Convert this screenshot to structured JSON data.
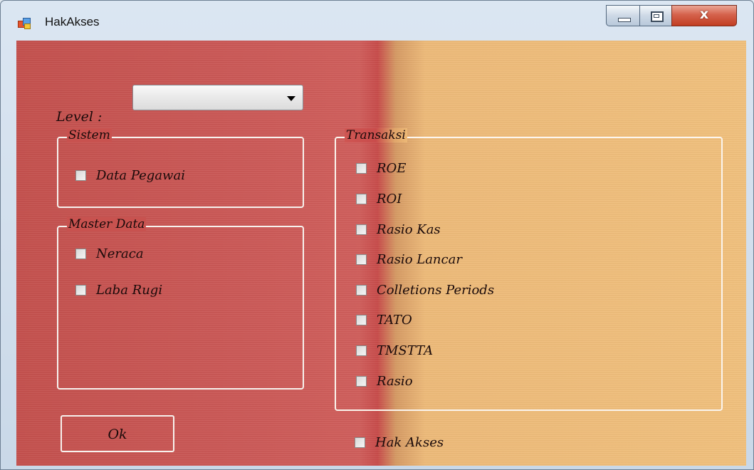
{
  "window": {
    "title": "HakAkses"
  },
  "titlebar_controls": {
    "close_glyph": "x"
  },
  "form": {
    "level_label": "Level :",
    "level_value": "",
    "sistem": {
      "title": "Sistem",
      "items": [
        "Data Pegawai"
      ]
    },
    "master_data": {
      "title": "Master Data",
      "items": [
        "Neraca",
        "Laba Rugi"
      ]
    },
    "transaksi": {
      "title": "Transaksi",
      "items": [
        "ROE",
        "ROI",
        "Rasio Kas",
        "Rasio Lancar",
        "Colletions Periods",
        "TATO",
        "TMSTTA",
        "Rasio"
      ]
    },
    "hak_akses_label": "Hak Akses",
    "ok_label": "Ok"
  },
  "colors": {
    "left_panel": "#c8524f",
    "right_panel": "#efbd7a",
    "group_border": "#f7f2ee"
  },
  "icons": [
    "app-icon",
    "minimize-icon",
    "maximize-icon",
    "close-icon",
    "dropdown-arrow-icon"
  ]
}
